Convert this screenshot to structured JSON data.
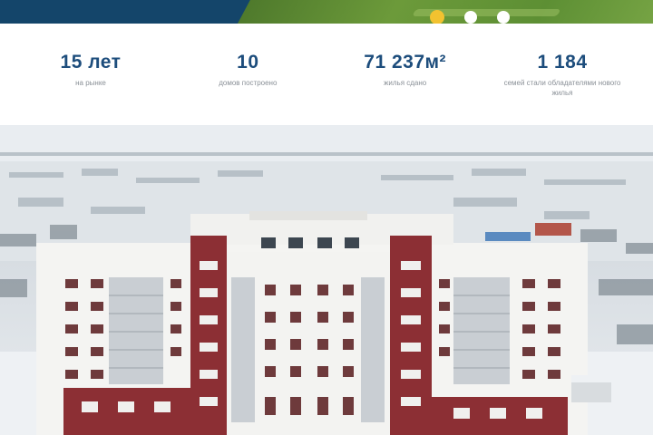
{
  "hero": {
    "slider_dots": [
      {
        "state": "active"
      },
      {
        "state": "inactive"
      },
      {
        "state": "inactive"
      }
    ],
    "colors": {
      "dark_blue": "#14456a",
      "green": "#6c9a3a",
      "dot_active": "#f2c230"
    }
  },
  "stats": [
    {
      "value": "15 лет",
      "label": "на рынке"
    },
    {
      "value": "10",
      "label": "домов построено"
    },
    {
      "value": "71 237м²",
      "label": "жилья сдано"
    },
    {
      "value": "1 184",
      "label": "семей стали обладателями нового жилья"
    }
  ],
  "photo": {
    "subject": "residential-building-aerial-winter",
    "colors": {
      "brick": "#8c2f34",
      "facade": "#f4f4f2",
      "snow": "#eef1f4"
    }
  }
}
